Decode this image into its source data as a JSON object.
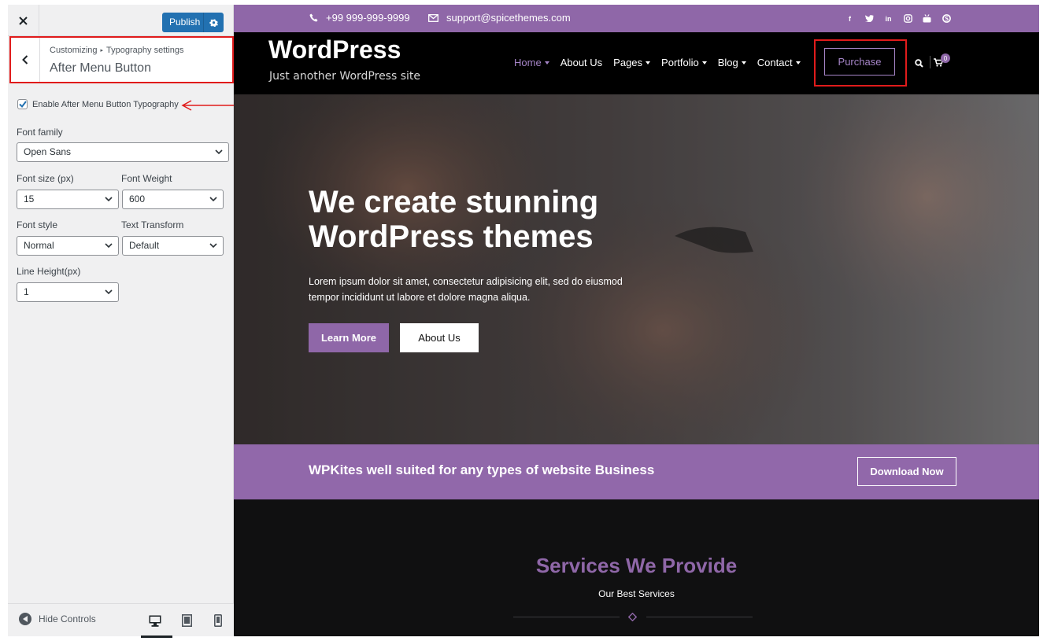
{
  "customizer": {
    "close_icon": "close-icon",
    "publish_label": "Publish",
    "settings_icon": "gear-icon",
    "breadcrumb": {
      "root": "Customizing",
      "parent": "Typography settings"
    },
    "section_title": "After Menu Button",
    "enable_label": "Enable After Menu Button Typography",
    "enable_checked": true,
    "fields": {
      "font_family": {
        "label": "Font family",
        "value": "Open Sans"
      },
      "font_size": {
        "label": "Font size (px)",
        "value": "15"
      },
      "font_weight": {
        "label": "Font Weight",
        "value": "600"
      },
      "font_style": {
        "label": "Font style",
        "value": "Normal"
      },
      "text_transform": {
        "label": "Text Transform",
        "value": "Default"
      },
      "line_height": {
        "label": "Line Height(px)",
        "value": "1"
      }
    },
    "footer": {
      "hide_controls_label": "Hide Controls",
      "devices": [
        "desktop-icon",
        "tablet-icon",
        "mobile-icon"
      ],
      "active_device": "desktop"
    }
  },
  "site": {
    "topbar": {
      "phone": "+99 999-999-9999",
      "email": "support@spicethemes.com",
      "social": [
        "facebook-icon",
        "twitter-icon",
        "linkedin-icon",
        "instagram-icon",
        "youtube-icon",
        "skype-icon"
      ]
    },
    "header": {
      "title": "WordPress",
      "tagline": "Just another WordPress site",
      "menu": [
        {
          "label": "Home",
          "dropdown": true,
          "active": true
        },
        {
          "label": "About Us",
          "dropdown": false,
          "active": false
        },
        {
          "label": "Pages",
          "dropdown": true,
          "active": false
        },
        {
          "label": "Portfolio",
          "dropdown": true,
          "active": false
        },
        {
          "label": "Blog",
          "dropdown": true,
          "active": false
        },
        {
          "label": "Contact",
          "dropdown": true,
          "active": false
        }
      ],
      "purchase_label": "Purchase",
      "cart_count": "0"
    },
    "hero": {
      "title_line1": "We create stunning",
      "title_line2": "WordPress themes",
      "text_line1": "Lorem ipsum dolor sit amet, consectetur adipisicing elit, sed do eiusmod",
      "text_line2": "tempor incididunt ut labore et dolore magna aliqua.",
      "primary_button": "Learn More",
      "secondary_button": "About Us"
    },
    "cta": {
      "text": "WPKites well suited for any types of website Business",
      "button": "Download Now"
    },
    "services": {
      "title": "Services We Provide",
      "subtitle": "Our Best Services"
    }
  },
  "colors": {
    "accent_purple": "#8f67a8",
    "publish_blue": "#2271b1",
    "annotation_red": "#e01b1b"
  }
}
